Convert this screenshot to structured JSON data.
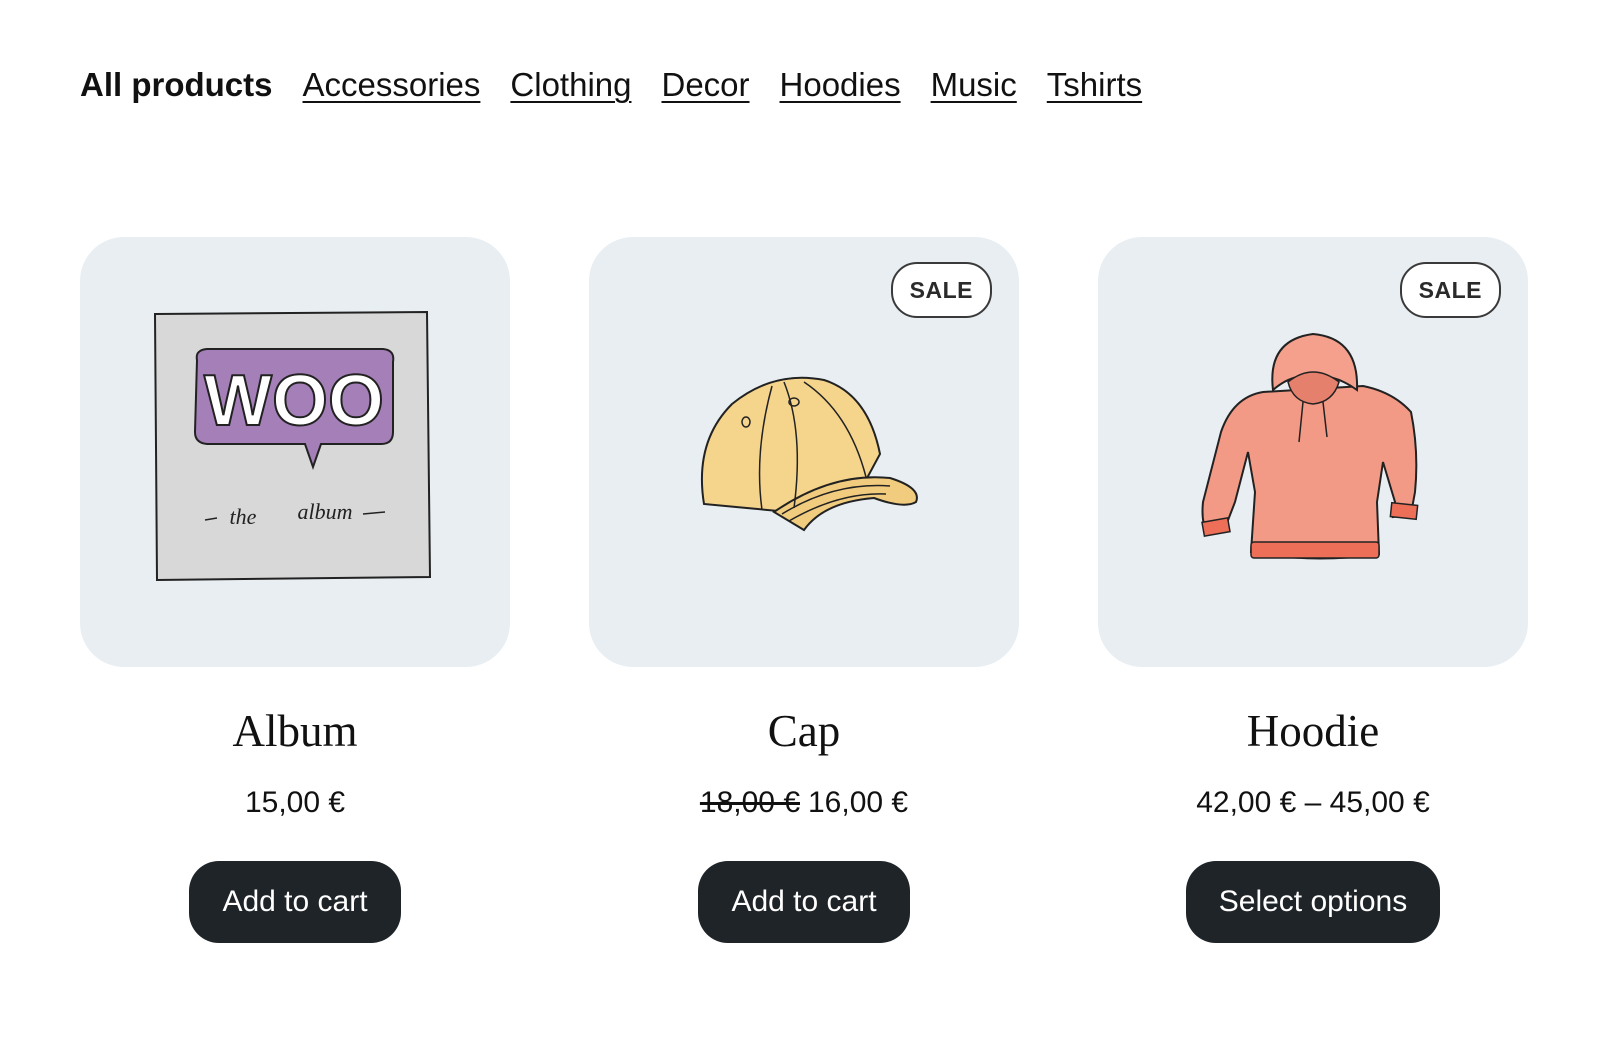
{
  "categories": {
    "current": "All products",
    "links": [
      "Accessories",
      "Clothing",
      "Decor",
      "Hoodies",
      "Music",
      "Tshirts"
    ]
  },
  "products": [
    {
      "title": "Album",
      "price": "15,00 €",
      "button": "Add to cart",
      "image": {
        "icon": "album-cover",
        "cover_text": "WOO",
        "caption_left": "the",
        "caption_right": "album"
      }
    },
    {
      "title": "Cap",
      "badge": "SALE",
      "old_price": "18,00 €",
      "price": "16,00 €",
      "button": "Add to cart",
      "image": {
        "icon": "cap"
      }
    },
    {
      "title": "Hoodie",
      "badge": "SALE",
      "price": "42,00 € – 45,00 €",
      "button": "Select options",
      "image": {
        "icon": "hoodie"
      }
    }
  ],
  "colors": {
    "thumb_bg": "#e8eef2",
    "button_bg": "#1f2428",
    "button_text": "#ffffff",
    "woo_purple": "#a57fb8",
    "cap_yellow": "#f5d48c",
    "hoodie_pink": "#f39a86"
  }
}
